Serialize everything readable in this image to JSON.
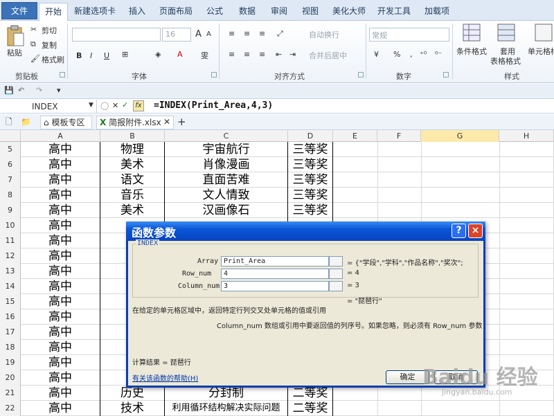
{
  "ribbon": {
    "tabs": [
      "文件",
      "开始",
      "新建选项卡",
      "插入",
      "页面布局",
      "公式",
      "数据",
      "审阅",
      "视图",
      "美化大师",
      "开发工具",
      "加载项"
    ],
    "clipboard": {
      "paste": "粘贴",
      "cut": "剪切",
      "copy": "复制",
      "format_painter": "格式刷",
      "group": "剪贴板"
    },
    "font": {
      "size": "16",
      "bold": "B",
      "italic": "I",
      "underline": "U",
      "group": "字体",
      "wen": "雯",
      "A": "A"
    },
    "align": {
      "wrap": "自动换行",
      "merge": "合并后居中",
      "group": "对齐方式"
    },
    "number": {
      "format": "常规",
      "pct": "%",
      "comma": ",",
      "group": "数字"
    },
    "styles": {
      "cond": "条件格式",
      "table1": "套用",
      "table2": "表格格式",
      "cell": "单元格样",
      "group": "样式"
    }
  },
  "formula_bar": {
    "name_box": "INDEX",
    "fx": "fx",
    "formula": "=INDEX(Print_Area,4,3)"
  },
  "doc_tabs": {
    "template": "模板专区",
    "file": "简报附件.xlsx",
    "new": "+"
  },
  "sheet": {
    "columns": [
      "A",
      "B",
      "C",
      "D",
      "E",
      "F",
      "G",
      "H"
    ],
    "rows": [
      {
        "n": "5",
        "a": "高中",
        "b": "物理",
        "c": "宇宙航行",
        "d": "三等奖"
      },
      {
        "n": "6",
        "a": "高中",
        "b": "美术",
        "c": "肖像漫画",
        "d": "三等奖"
      },
      {
        "n": "7",
        "a": "高中",
        "b": "语文",
        "c": "直面苦难",
        "d": "三等奖"
      },
      {
        "n": "8",
        "a": "高中",
        "b": "音乐",
        "c": "文人情致",
        "d": "三等奖"
      },
      {
        "n": "9",
        "a": "高中",
        "b": "美术",
        "c": "汉画像石",
        "d": "三等奖"
      },
      {
        "n": "10",
        "a": "高中",
        "b": "",
        "c": "",
        "d": ""
      },
      {
        "n": "11",
        "a": "高中",
        "b": "",
        "c": "",
        "d": ""
      },
      {
        "n": "12",
        "a": "高中",
        "b": "",
        "c": "",
        "d": ""
      },
      {
        "n": "13",
        "a": "高中",
        "b": "",
        "c": "",
        "d": ""
      },
      {
        "n": "14",
        "a": "高中",
        "b": "",
        "c": "",
        "d": ""
      },
      {
        "n": "15",
        "a": "高中",
        "b": "",
        "c": "",
        "d": ""
      },
      {
        "n": "16",
        "a": "高中",
        "b": "",
        "c": "",
        "d": ""
      },
      {
        "n": "17",
        "a": "高中",
        "b": "",
        "c": "",
        "d": ""
      },
      {
        "n": "18",
        "a": "高中",
        "b": "",
        "c": "",
        "d": ""
      },
      {
        "n": "19",
        "a": "高中",
        "b": "",
        "c": "",
        "d": ""
      },
      {
        "n": "20",
        "a": "高中",
        "b": "",
        "c": "",
        "d": ""
      },
      {
        "n": "21",
        "a": "高中",
        "b": "历史",
        "c": "分封制",
        "d": "二等奖"
      },
      {
        "n": "22",
        "a": "高中",
        "b": "技术",
        "c": "利用循环结构解决实际问题",
        "d": "二等奖"
      }
    ]
  },
  "dialog": {
    "title": "函数参数",
    "help_btn": "?",
    "close_btn": "×",
    "group": "INDEX",
    "array_label": "Array",
    "array_value": "Print_Area",
    "array_result": "= {\"学段\",\"学科\",\"作品名称\",\"奖次\";",
    "row_label": "Row_num",
    "row_value": "4",
    "row_result": "= 4",
    "col_label": "Column_num",
    "col_value": "3",
    "col_result": "= 3",
    "overall_result": "= \"琵琶行\"",
    "description": "在给定的单元格区域中，返回特定行列交叉处单元格的值或引用",
    "param_desc": "Column_num  数组或引用中要返回值的列序号。如果忽略，则必须有 Row_num 参数",
    "calc_result": "计算结果 = 琵琶行",
    "help_link": "有关该函数的帮助(H)",
    "ok": "确定",
    "cancel": "取消"
  },
  "watermark": {
    "main": "Baidu 经验",
    "sub": "jingyan.baidu.com"
  },
  "colors": {
    "selected_col": "#fde9a9",
    "dialog_title": "#0a55d6",
    "file_tab": "#3c73b8"
  }
}
